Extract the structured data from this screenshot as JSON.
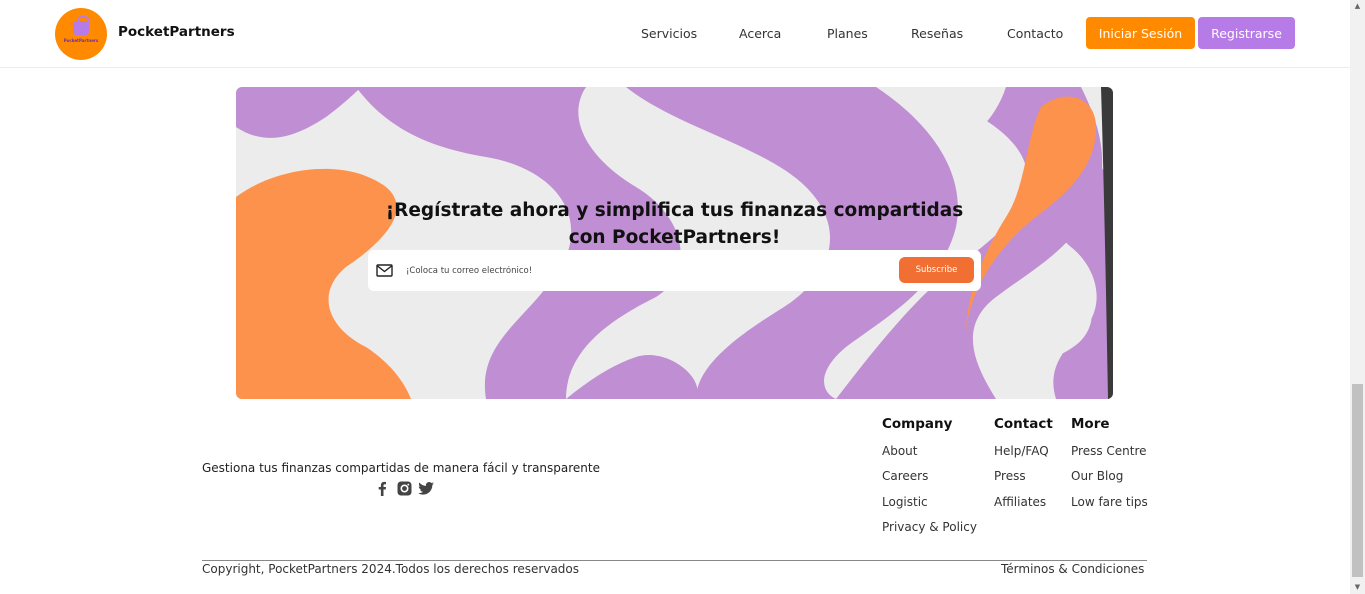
{
  "header": {
    "brand": "PocketPartners",
    "logo_text": "PocketPartners",
    "nav": [
      "Servicios",
      "Acerca",
      "Planes",
      "Reseñas",
      "Contacto"
    ],
    "login_label": "Iniciar Sesión",
    "register_label": "Registrarse"
  },
  "banner": {
    "title": "¡Regístrate ahora y simplifica tus finanzas compartidas con PocketPartners!",
    "input_placeholder": "¡Coloca tu correo electrónico!",
    "input_value": "",
    "subscribe_label": "Subscribe"
  },
  "footer": {
    "tagline": "Gestiona tus finanzas compartidas de manera fácil y transparente",
    "social_icons": [
      "facebook-icon",
      "instagram-icon",
      "twitter-icon"
    ],
    "columns": [
      {
        "title": "Company",
        "links": [
          "About",
          "Careers",
          "Logistic",
          "Privacy & Policy"
        ]
      },
      {
        "title": "Contact",
        "links": [
          "Help/FAQ",
          "Press",
          "Affiliates"
        ]
      },
      {
        "title": "More",
        "links": [
          "Press Centre",
          "Our Blog",
          "Low fare tips"
        ]
      }
    ],
    "copyright": "Copyright, PocketPartners 2024.Todos los derechos reservados",
    "terms": "Términos & Condiciones"
  },
  "colors": {
    "orange": "#ff8a00",
    "purple": "#b77be8",
    "subscribe": "#f26f34"
  }
}
